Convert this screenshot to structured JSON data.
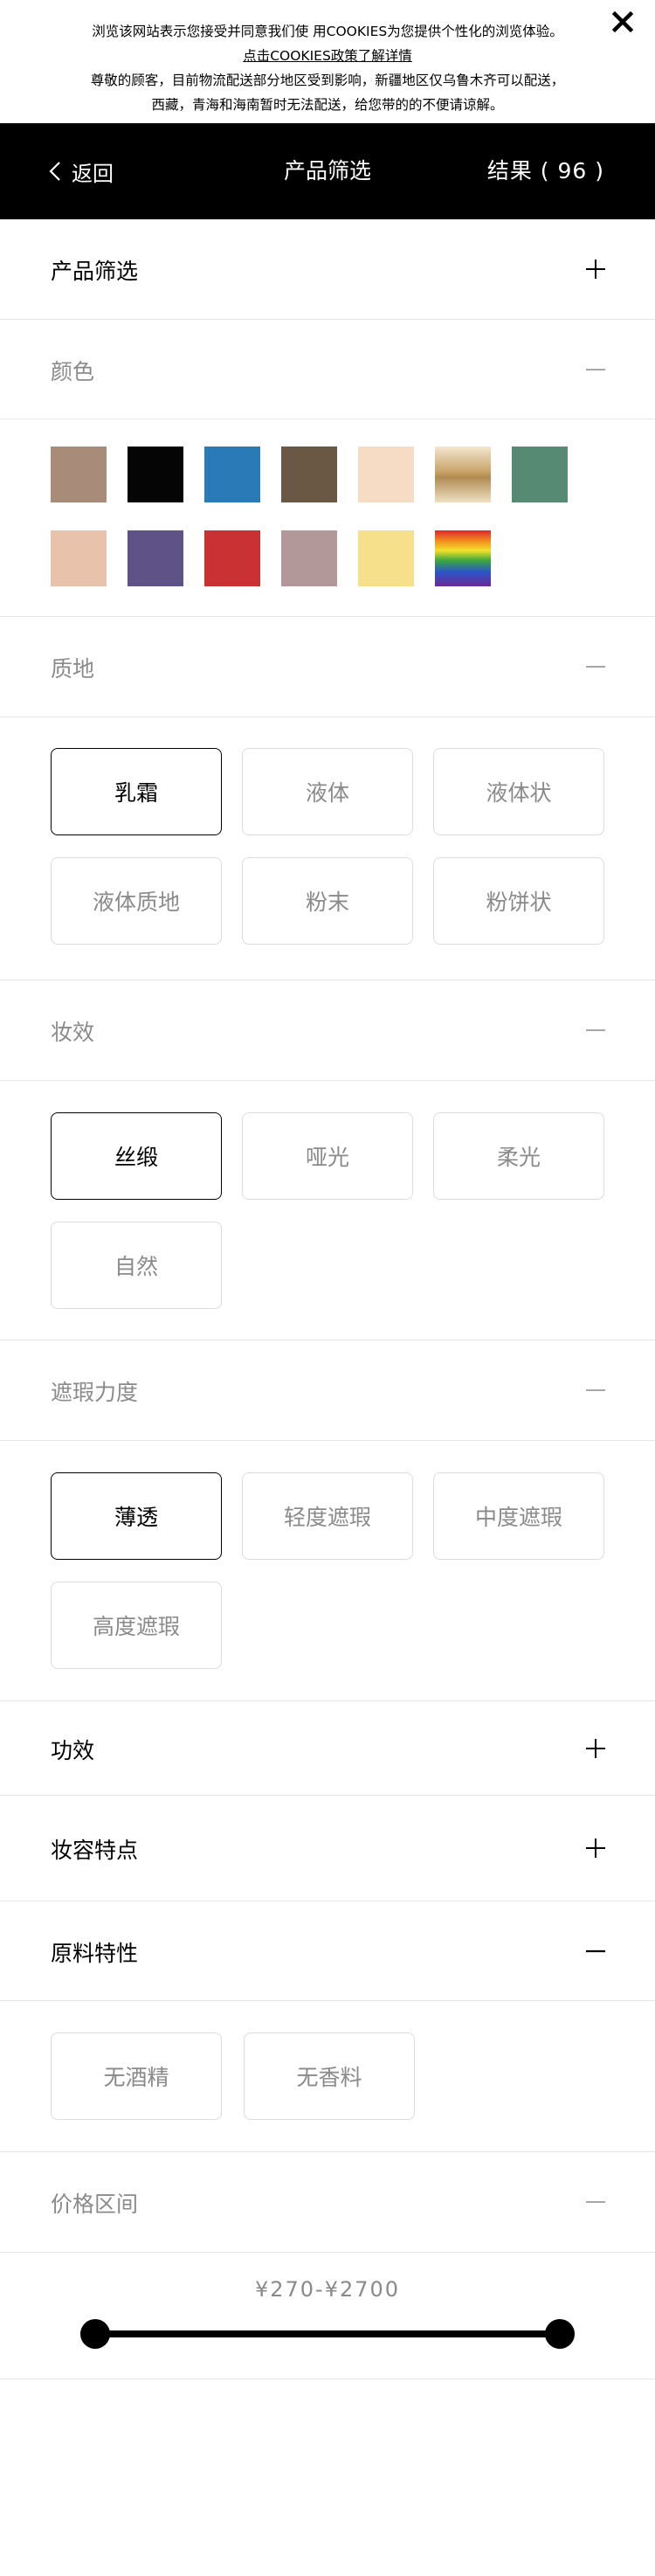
{
  "cookie_banner": {
    "line1": "浏览该网站表示您接受并同意我们使 用COOKIES为您提供个性化的浏览体验。",
    "line2": "点击COOKIES政策了解详情",
    "line3": "尊敬的顾客，目前物流配送部分地区受到影响，新疆地区仅乌鲁木齐可以配送，",
    "line4": "西藏，青海和海南暂时无法配送，给您带的的不便请谅解。"
  },
  "header": {
    "back_label": "返回",
    "title": "产品筛选",
    "results_label": "结果 ( 96 )"
  },
  "sections": {
    "product_filter": "产品筛选",
    "color": "颜色",
    "texture": "质地",
    "finish": "妆效",
    "coverage": "遮瑕力度",
    "benefit": "功效",
    "look": "妆容特点",
    "ingredients": "原料特性",
    "price": "价格区间"
  },
  "colors": [
    {
      "name": "brown",
      "hex": "#a98b7a"
    },
    {
      "name": "black",
      "hex": "#050505"
    },
    {
      "name": "blue",
      "hex": "#2a7ab8"
    },
    {
      "name": "dark-brown",
      "hex": "#6a5744"
    },
    {
      "name": "peach",
      "hex": "#f7dcc5"
    },
    {
      "name": "gold",
      "hex": "#c7a16a"
    },
    {
      "name": "green",
      "hex": "#578a72"
    },
    {
      "name": "nude",
      "hex": "#e8c2ab"
    },
    {
      "name": "purple",
      "hex": "#5f5287"
    },
    {
      "name": "red",
      "hex": "#c93133"
    },
    {
      "name": "mauve",
      "hex": "#b39899"
    },
    {
      "name": "yellow",
      "hex": "#f6e08c"
    },
    {
      "name": "rainbow",
      "hex": "rainbow"
    }
  ],
  "texture_options": [
    {
      "label": "乳霜",
      "selected": true
    },
    {
      "label": "液体",
      "selected": false
    },
    {
      "label": "液体状",
      "selected": false
    },
    {
      "label": "液体质地",
      "selected": false
    },
    {
      "label": "粉末",
      "selected": false
    },
    {
      "label": "粉饼状",
      "selected": false
    }
  ],
  "finish_options": [
    {
      "label": "丝缎",
      "selected": true
    },
    {
      "label": "哑光",
      "selected": false
    },
    {
      "label": "柔光",
      "selected": false
    },
    {
      "label": "自然",
      "selected": false
    }
  ],
  "coverage_options": [
    {
      "label": "薄透",
      "selected": true
    },
    {
      "label": "轻度遮瑕",
      "selected": false
    },
    {
      "label": "中度遮瑕",
      "selected": false
    },
    {
      "label": "高度遮瑕",
      "selected": false
    }
  ],
  "ingredient_options": [
    {
      "label": "无酒精",
      "selected": false
    },
    {
      "label": "无香料",
      "selected": false
    }
  ],
  "price": {
    "range_text": "¥270-¥2700",
    "min": 270,
    "max": 2700
  }
}
